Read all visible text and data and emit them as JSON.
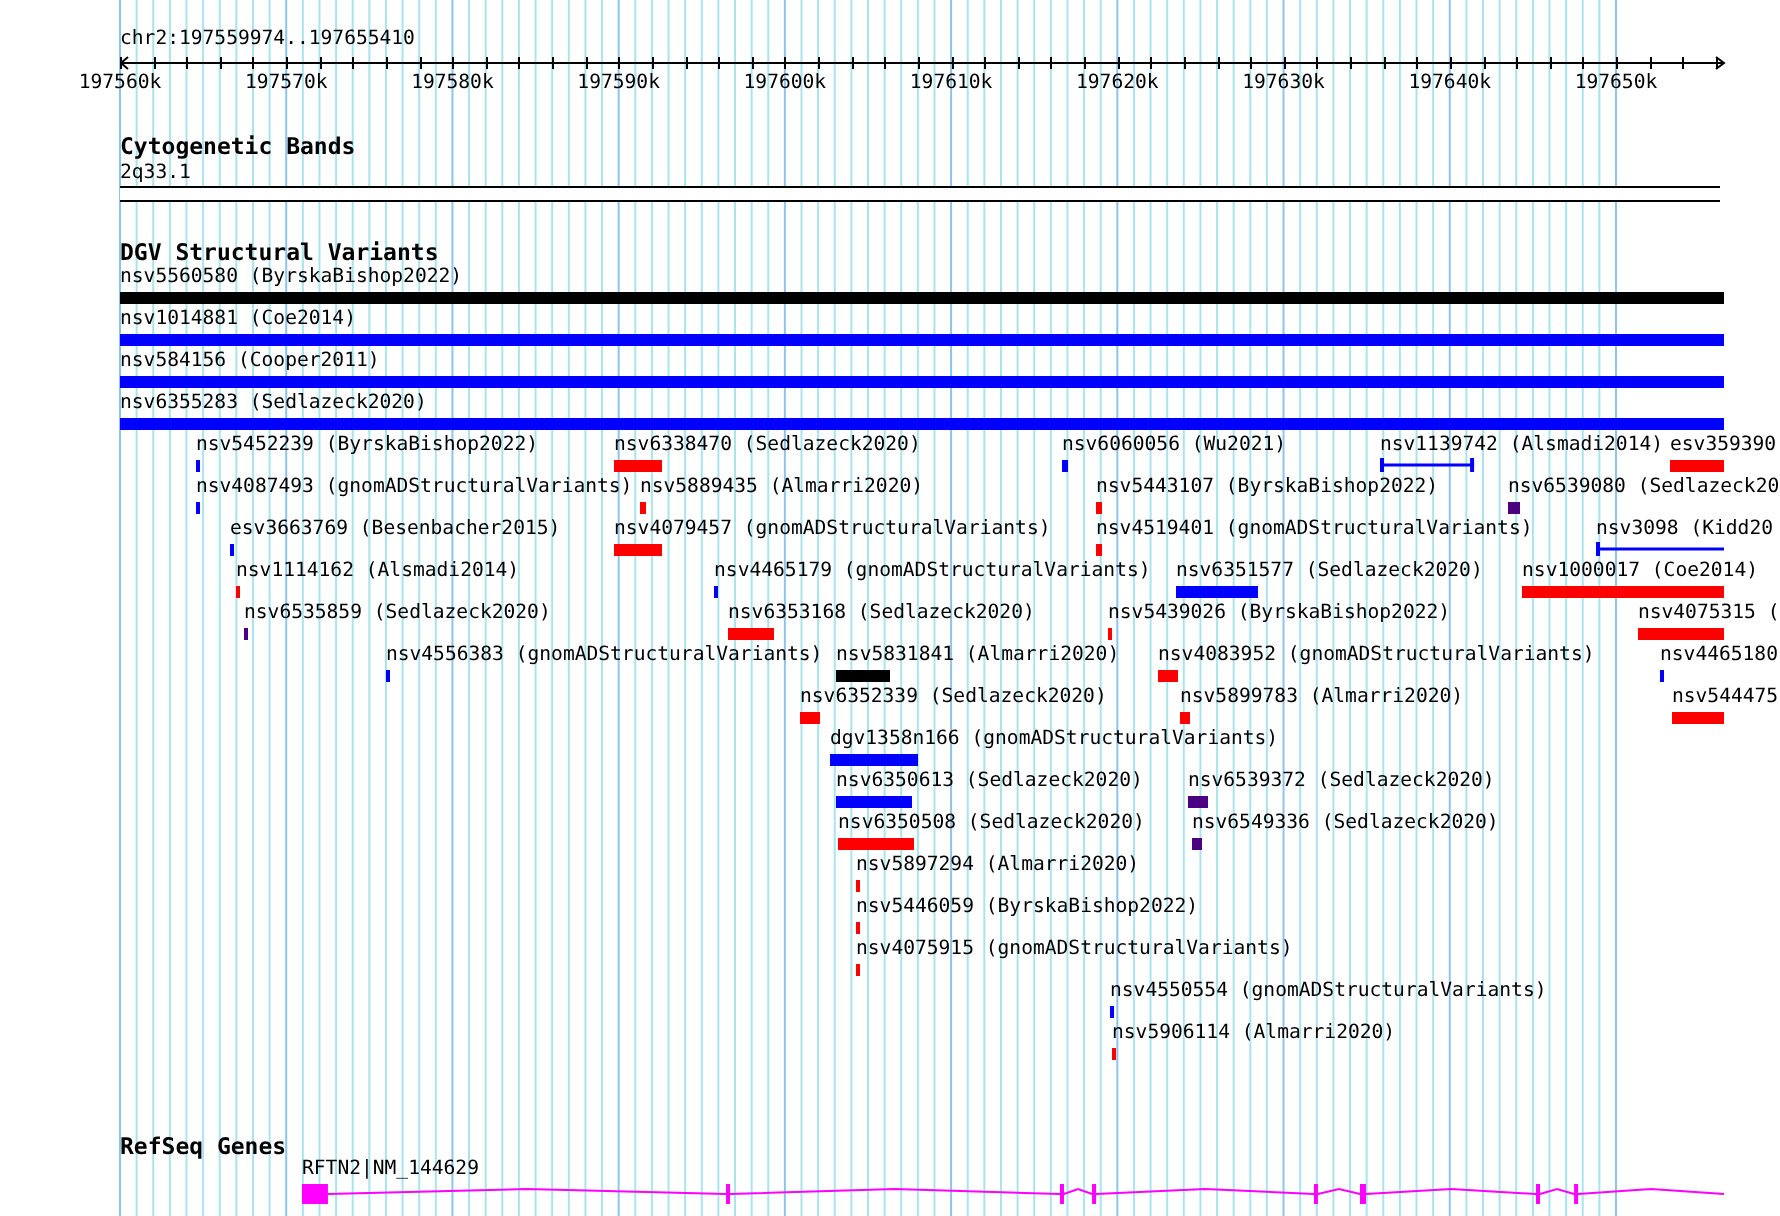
{
  "locus": "chr2:197559974..197655410",
  "ruler": {
    "ticks": [
      "197560k",
      "197570k",
      "197580k",
      "197590k",
      "197600k",
      "197610k",
      "197620k",
      "197630k",
      "197640k",
      "197650k"
    ]
  },
  "cytogenetic_bands": {
    "title": "Cytogenetic Bands",
    "band": "2q33.1"
  },
  "dgv": {
    "title": "DGV Structural Variants",
    "variants": [
      {
        "label": "nsv5560580 (ByrskaBishop2022)",
        "color": "#000000",
        "kind": "bar"
      },
      {
        "label": "nsv1014881 (Coe2014)",
        "color": "#0000ff",
        "kind": "bar"
      },
      {
        "label": "nsv584156 (Cooper2011)",
        "color": "#0000ff",
        "kind": "bar"
      },
      {
        "label": "nsv6355283 (Sedlazeck2020)",
        "color": "#0000ff",
        "kind": "bar"
      },
      {
        "label": "nsv5452239 (ByrskaBishop2022)",
        "color": "#0000ff",
        "kind": "bar"
      },
      {
        "label": "nsv6338470 (Sedlazeck2020)",
        "color": "#ff0000",
        "kind": "bar"
      },
      {
        "label": "nsv6060056 (Wu2021)",
        "color": "#0000ff",
        "kind": "bar"
      },
      {
        "label": "nsv1139742 (Alsmadi2014)",
        "color": "#0000ff",
        "kind": "line"
      },
      {
        "label": "esv359390",
        "color": "#ff0000",
        "kind": "bar"
      },
      {
        "label": "nsv4087493 (gnomADStructuralVariants)",
        "color": "#0000ff",
        "kind": "bar"
      },
      {
        "label": "nsv5889435 (Almarri2020)",
        "color": "#ff0000",
        "kind": "bar"
      },
      {
        "label": "nsv5443107 (ByrskaBishop2022)",
        "color": "#ff0000",
        "kind": "bar"
      },
      {
        "label": "nsv6539080 (Sedlazeck20",
        "color": "#4b0082",
        "kind": "bar"
      },
      {
        "label": "esv3663769 (Besenbacher2015)",
        "color": "#0000ff",
        "kind": "bar"
      },
      {
        "label": "nsv4079457 (gnomADStructuralVariants)",
        "color": "#ff0000",
        "kind": "bar"
      },
      {
        "label": "nsv4519401 (gnomADStructuralVariants)",
        "color": "#ff0000",
        "kind": "bar"
      },
      {
        "label": "nsv3098 (Kidd20",
        "color": "#0000ff",
        "kind": "line"
      },
      {
        "label": "nsv1114162 (Alsmadi2014)",
        "color": "#ff0000",
        "kind": "bar"
      },
      {
        "label": "nsv4465179 (gnomADStructuralVariants)",
        "color": "#0000ff",
        "kind": "bar"
      },
      {
        "label": "nsv6351577 (Sedlazeck2020)",
        "color": "#0000ff",
        "kind": "bar"
      },
      {
        "label": "nsv1000017 (Coe2014)",
        "color": "#ff0000",
        "kind": "bar"
      },
      {
        "label": "nsv6535859 (Sedlazeck2020)",
        "color": "#4b0082",
        "kind": "bar"
      },
      {
        "label": "nsv6353168 (Sedlazeck2020)",
        "color": "#ff0000",
        "kind": "bar"
      },
      {
        "label": "nsv5439026 (ByrskaBishop2022)",
        "color": "#ff0000",
        "kind": "bar"
      },
      {
        "label": "nsv4075315 (",
        "color": "#ff0000",
        "kind": "bar"
      },
      {
        "label": "nsv4556383 (gnomADStructuralVariants)",
        "color": "#0000ff",
        "kind": "bar"
      },
      {
        "label": "nsv5831841 (Almarri2020)",
        "color": "#000000",
        "kind": "bar"
      },
      {
        "label": "nsv4083952 (gnomADStructuralVariants)",
        "color": "#ff0000",
        "kind": "bar"
      },
      {
        "label": "nsv4465180",
        "color": "#0000ff",
        "kind": "bar"
      },
      {
        "label": "nsv6352339 (Sedlazeck2020)",
        "color": "#ff0000",
        "kind": "bar"
      },
      {
        "label": "nsv5899783 (Almarri2020)",
        "color": "#ff0000",
        "kind": "bar"
      },
      {
        "label": "nsv544475",
        "color": "#ff0000",
        "kind": "bar"
      },
      {
        "label": "dgv1358n166 (gnomADStructuralVariants)",
        "color": "#0000ff",
        "kind": "bar"
      },
      {
        "label": "nsv6350613 (Sedlazeck2020)",
        "color": "#0000ff",
        "kind": "bar"
      },
      {
        "label": "nsv6539372 (Sedlazeck2020)",
        "color": "#4b0082",
        "kind": "bar"
      },
      {
        "label": "nsv6350508 (Sedlazeck2020)",
        "color": "#ff0000",
        "kind": "bar"
      },
      {
        "label": "nsv6549336 (Sedlazeck2020)",
        "color": "#4b0082",
        "kind": "bar"
      },
      {
        "label": "nsv5897294 (Almarri2020)",
        "color": "#ff0000",
        "kind": "bar"
      },
      {
        "label": "nsv5446059 (ByrskaBishop2022)",
        "color": "#ff0000",
        "kind": "bar"
      },
      {
        "label": "nsv4075915 (gnomADStructuralVariants)",
        "color": "#ff0000",
        "kind": "bar"
      },
      {
        "label": "nsv4550554 (gnomADStructuralVariants)",
        "color": "#0000ff",
        "kind": "bar"
      },
      {
        "label": "nsv5906114 (Almarri2020)",
        "color": "#ff0000",
        "kind": "bar"
      }
    ]
  },
  "refseq": {
    "title": "RefSeq Genes",
    "genes": [
      {
        "label": "RFTN2|NM_144629"
      }
    ]
  }
}
